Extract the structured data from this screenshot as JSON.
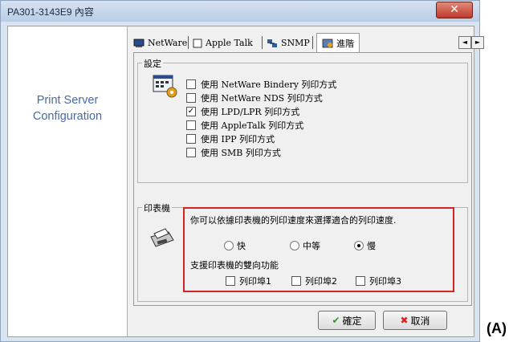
{
  "window": {
    "title": "PA301-3143E9 內容",
    "close_glyph": "✕"
  },
  "left_panel": {
    "label_line1": "Print Server",
    "label_line2": "Configuration"
  },
  "tabs": [
    {
      "label": "NetWare",
      "icon": "network-icon"
    },
    {
      "label": "Apple Talk",
      "icon": "apple-talk-icon"
    },
    {
      "label": "SNMP",
      "icon": "snmp-icon"
    },
    {
      "label": "進階",
      "icon": "advanced-icon",
      "active": true
    }
  ],
  "tab_scroll": {
    "left": "◄",
    "right": "►"
  },
  "settings_group": {
    "title": "設定",
    "options": [
      {
        "label": "使用 NetWare Bindery 列印方式",
        "checked": false
      },
      {
        "label": "使用 NetWare NDS 列印方式",
        "checked": false
      },
      {
        "label": "使用 LPD/LPR 列印方式",
        "checked": true
      },
      {
        "label": "使用 AppleTalk 列印方式",
        "checked": false
      },
      {
        "label": "使用 IPP 列印方式",
        "checked": false
      },
      {
        "label": "使用 SMB 列印方式",
        "checked": false
      }
    ]
  },
  "printer_group": {
    "title": "印表機",
    "description": "你可以依據印表機的列印速度來選擇適合的列印速度.",
    "speeds": [
      {
        "label": "快",
        "selected": false
      },
      {
        "label": "中等",
        "selected": false
      },
      {
        "label": "慢",
        "selected": true
      }
    ],
    "bidirectional_label": "支援印表機的雙向功能",
    "ports": [
      {
        "label": "列印埠1",
        "checked": false
      },
      {
        "label": "列印埠2",
        "checked": false
      },
      {
        "label": "列印埠3",
        "checked": false
      }
    ]
  },
  "buttons": {
    "ok": "確定",
    "cancel": "取消"
  },
  "figure_label": "(A)",
  "colors": {
    "highlight_border": "#d42424",
    "left_text": "#4a6aa5"
  }
}
